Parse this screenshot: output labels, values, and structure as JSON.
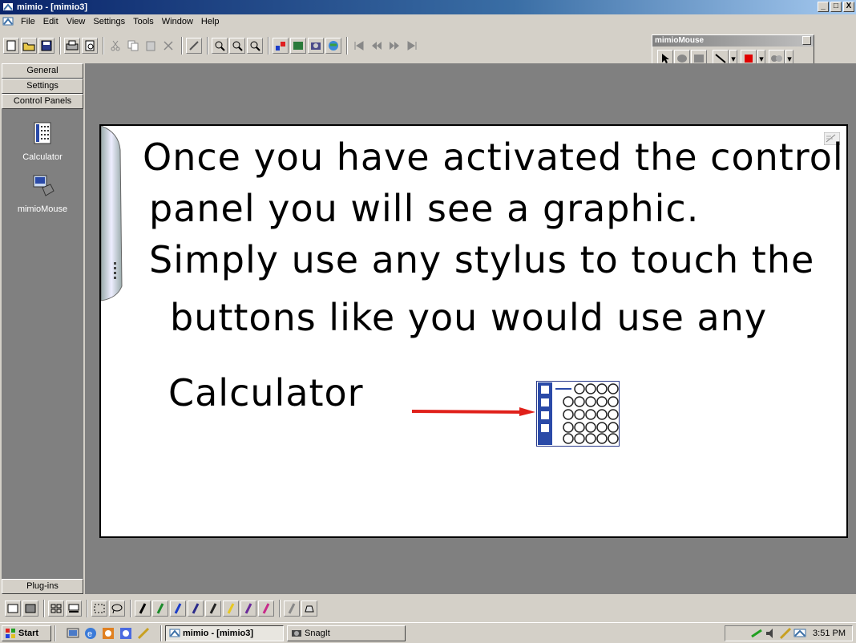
{
  "window": {
    "title": "mimio - [mimio3]",
    "controls": [
      "_",
      "□",
      "X"
    ]
  },
  "menubar": {
    "items": [
      "File",
      "Edit",
      "View",
      "Settings",
      "Tools",
      "Window",
      "Help"
    ]
  },
  "toolbar": {
    "icons": [
      "new-icon",
      "open-icon",
      "save-icon",
      "print-icon",
      "print-preview-icon",
      "cut-icon",
      "copy-icon",
      "paste-icon",
      "delete-icon",
      "pen-icon",
      "zoom-in-icon",
      "zoom-out-icon",
      "zoom-fit-icon",
      "color-icon",
      "image-icon",
      "camera-icon",
      "web-icon",
      "first-page-icon",
      "prev-page-icon",
      "next-page-icon",
      "last-page-icon"
    ]
  },
  "mimio_mouse": {
    "title": "mimioMouse",
    "tools": [
      "arrow-icon",
      "ellipse-icon",
      "rectangle-icon",
      "line-icon",
      "color-red-icon",
      "settings-icon"
    ]
  },
  "sidebar": {
    "tabs": [
      "General",
      "Settings",
      "Control Panels"
    ],
    "items": [
      {
        "label": "Calculator",
        "icon": "calculator-icon"
      },
      {
        "label": "mimioMouse",
        "icon": "mimio-mouse-icon"
      }
    ],
    "plugins_tab": "Plug-ins"
  },
  "board": {
    "handwriting": [
      "Once you have activated the control",
      "panel you will see a graphic.",
      "Simply use any stylus to touch the",
      "buttons like you would use any",
      "Calculator"
    ],
    "arrow_color": "#e0201a"
  },
  "bottom_toolbar": {
    "icons": [
      "page-view-icon",
      "save-page-icon",
      "grid-icon",
      "slides-icon",
      "select-icon",
      "lasso-icon",
      "pen-black-icon",
      "pen-green-icon",
      "pen-blue-icon",
      "pen-blue2-icon",
      "pen-black2-icon",
      "pen-yellow-icon",
      "pen-purple-icon",
      "pen-magenta-icon",
      "eraser-icon",
      "highlighter-icon"
    ]
  },
  "taskbar": {
    "start_label": "Start",
    "tasks": [
      "mimio - [mimio3]",
      "SnagIt"
    ],
    "clock": "3:51 PM"
  }
}
